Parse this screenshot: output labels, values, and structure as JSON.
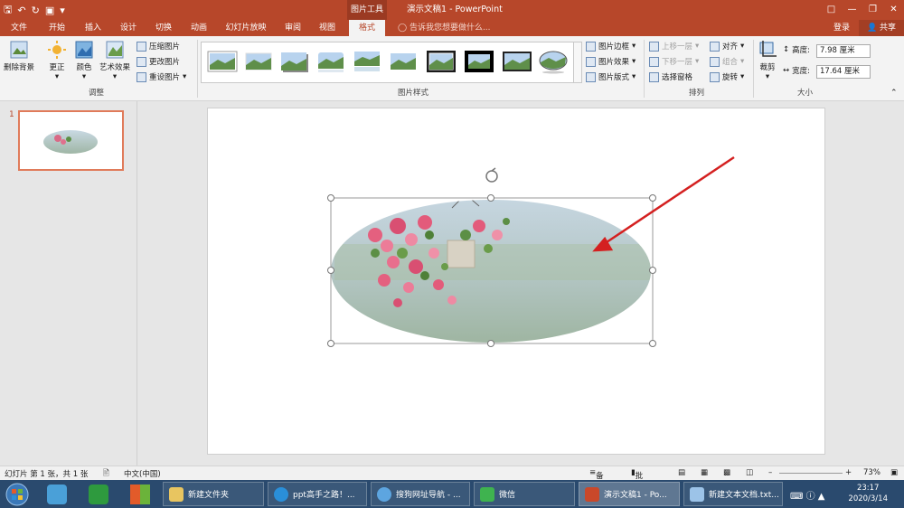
{
  "window": {
    "title": "演示文稿1 - PowerPoint",
    "contextual_tools": "图片工具"
  },
  "tabs": [
    "文件",
    "开始",
    "插入",
    "设计",
    "切换",
    "动画",
    "幻灯片放映",
    "审阅",
    "视图",
    "格式"
  ],
  "active_tab": "格式",
  "tell_me": "告诉我您想要做什么...",
  "login": "登录",
  "share": "共享",
  "ribbon": {
    "remove_bg": "删除背景",
    "corrections": "更正",
    "color": "颜色",
    "artistic": "艺术效果",
    "compress": "压缩图片",
    "change": "更改图片",
    "reset": "重设图片",
    "adjust_group": "调整",
    "picture_border": "图片边框",
    "picture_effects": "图片效果",
    "picture_layout": "图片版式",
    "styles_group": "图片样式",
    "bring_forward": "上移一层",
    "send_backward": "下移一层",
    "selection_pane": "选择窗格",
    "align": "对齐",
    "group": "组合",
    "rotate": "旋转",
    "arrange_group": "排列",
    "crop": "裁剪",
    "height_label": "高度:",
    "height_value": "7.98 厘米",
    "width_label": "宽度:",
    "width_value": "17.64 厘米",
    "size_group": "大小"
  },
  "thumbnail_number": "1",
  "status": {
    "slide_info": "幻灯片 第 1 张，共 1 张",
    "language": "中文(中国)",
    "notes": "备注",
    "comments": "批注",
    "zoom": "73%"
  },
  "taskbar": {
    "items": [
      "新建文件夹",
      "ppt高手之路！...",
      "搜狗网址导航 - ...",
      "微信",
      "演示文稿1 - Po...",
      "新建文本文档.txt..."
    ],
    "time": "23:17",
    "date": "2020/3/14"
  },
  "colors": {
    "accent": "#b7472a",
    "arrow": "#d42020"
  }
}
